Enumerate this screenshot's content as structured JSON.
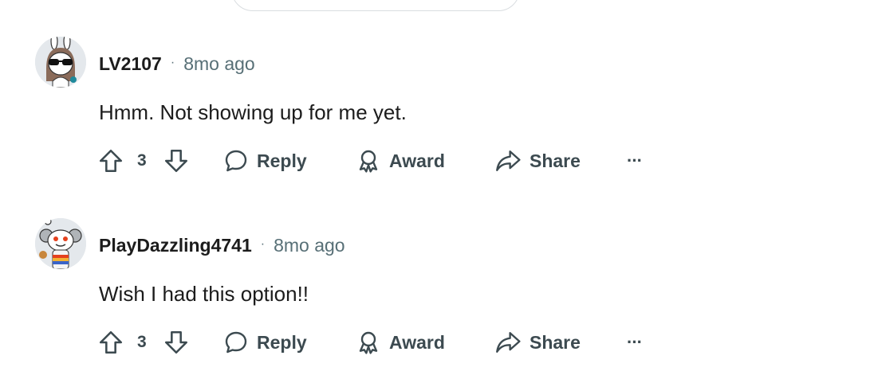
{
  "comments": [
    {
      "username": "LV2107",
      "separator": "·",
      "time": "8mo ago",
      "text": "Hmm. Not showing up for me yet.",
      "score": "3",
      "reply_label": "Reply",
      "award_label": "Award",
      "share_label": "Share",
      "more_label": "···"
    },
    {
      "username": "PlayDazzling4741",
      "separator": "·",
      "time": "8mo ago",
      "text": "Wish I had this option!!",
      "score": "3",
      "reply_label": "Reply",
      "award_label": "Award",
      "share_label": "Share",
      "more_label": "···"
    }
  ],
  "colors": {
    "text": "#1c1c1c",
    "muted": "#576f76",
    "action": "#3c4a50",
    "avatar_bg": "#e4e8ec"
  },
  "icons": {
    "upvote": "arrow-up-icon",
    "downvote": "arrow-down-icon",
    "reply": "speech-bubble-icon",
    "award": "ribbon-award-icon",
    "share": "share-arrow-icon",
    "more": "ellipsis-icon"
  }
}
